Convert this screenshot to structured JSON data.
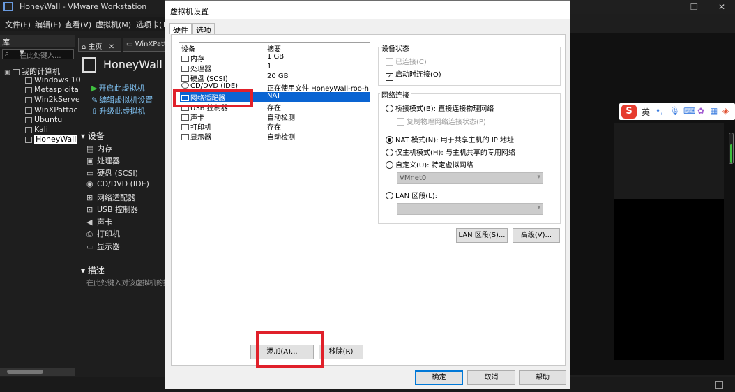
{
  "window": {
    "title": "HoneyWall - VMware Workstation"
  },
  "menubar": [
    {
      "label": "文件(F)"
    },
    {
      "label": "编辑(E)"
    },
    {
      "label": "查看(V)"
    },
    {
      "label": "虚拟机(M)"
    },
    {
      "label": "选项卡(T)"
    }
  ],
  "library": {
    "title": "库",
    "search_placeholder": "在此处键入...",
    "root": "我的计算机",
    "items": [
      {
        "label": "Windows 10"
      },
      {
        "label": "Metasploita"
      },
      {
        "label": "Win2kServe"
      },
      {
        "label": "WinXPattac"
      },
      {
        "label": "Ubuntu"
      },
      {
        "label": "Kali"
      },
      {
        "label": "HoneyWall"
      }
    ]
  },
  "tabs": [
    {
      "label": "主页"
    },
    {
      "label": "WinXPatta"
    }
  ],
  "vm": {
    "name": "HoneyWall",
    "actions": [
      {
        "label": "开启此虚拟机"
      },
      {
        "label": "编辑虚拟机设置"
      },
      {
        "label": "升级此虚拟机"
      }
    ],
    "devices_heading": "设备",
    "devices": [
      {
        "label": "内存",
        "icon": "memory-icon"
      },
      {
        "label": "处理器",
        "icon": "cpu-icon"
      },
      {
        "label": "硬盘 (SCSI)",
        "icon": "hdd-icon"
      },
      {
        "label": "CD/DVD (IDE)",
        "icon": "cd-icon"
      },
      {
        "label": "网络适配器",
        "icon": "network-icon"
      },
      {
        "label": "USB 控制器",
        "icon": "usb-icon"
      },
      {
        "label": "声卡",
        "icon": "sound-icon"
      },
      {
        "label": "打印机",
        "icon": "printer-icon"
      },
      {
        "label": "显示器",
        "icon": "display-icon"
      }
    ],
    "description_heading": "描述",
    "description_hint": "在此处键入对该虚拟机的描"
  },
  "ime": {
    "label": "英",
    "dots": "•,"
  },
  "dialog": {
    "title": "虚拟机设置",
    "tabs": [
      {
        "label": "硬件"
      },
      {
        "label": "选项"
      }
    ],
    "list_headers": {
      "device": "设备",
      "summary": "摘要"
    },
    "hardware": [
      {
        "device": "内存",
        "summary": "1 GB"
      },
      {
        "device": "处理器",
        "summary": "1"
      },
      {
        "device": "硬盘 (SCSI)",
        "summary": "20 GB"
      },
      {
        "device": "CD/DVD (IDE)",
        "summary": "正在使用文件 HoneyWall-roo-h..."
      },
      {
        "device": "网络适配器",
        "summary": "NAT"
      },
      {
        "device": "USB 控制器",
        "summary": "存在"
      },
      {
        "device": "声卡",
        "summary": "自动检测"
      },
      {
        "device": "打印机",
        "summary": "存在"
      },
      {
        "device": "显示器",
        "summary": "自动检测"
      }
    ],
    "add_button": "添加(A)...",
    "remove_button": "移除(R)",
    "device_status": {
      "title": "设备状态",
      "connected": "已连接(C)",
      "connect_on_power": "启动时连接(O)"
    },
    "network": {
      "title": "网络连接",
      "bridged": "桥接模式(B): 直接连接物理网络",
      "replicate": "复制物理网络连接状态(P)",
      "nat": "NAT 模式(N): 用于共享主机的 IP 地址",
      "host_only": "仅主机模式(H): 与主机共享的专用网络",
      "custom": "自定义(U): 特定虚拟网络",
      "custom_value": "VMnet0",
      "lan": "LAN 区段(L):",
      "lan_value": ""
    },
    "lan_segments_button": "LAN 区段(S)...",
    "advanced_button": "高级(V)...",
    "ok_button": "确定",
    "cancel_button": "取消",
    "help_button": "帮助"
  }
}
